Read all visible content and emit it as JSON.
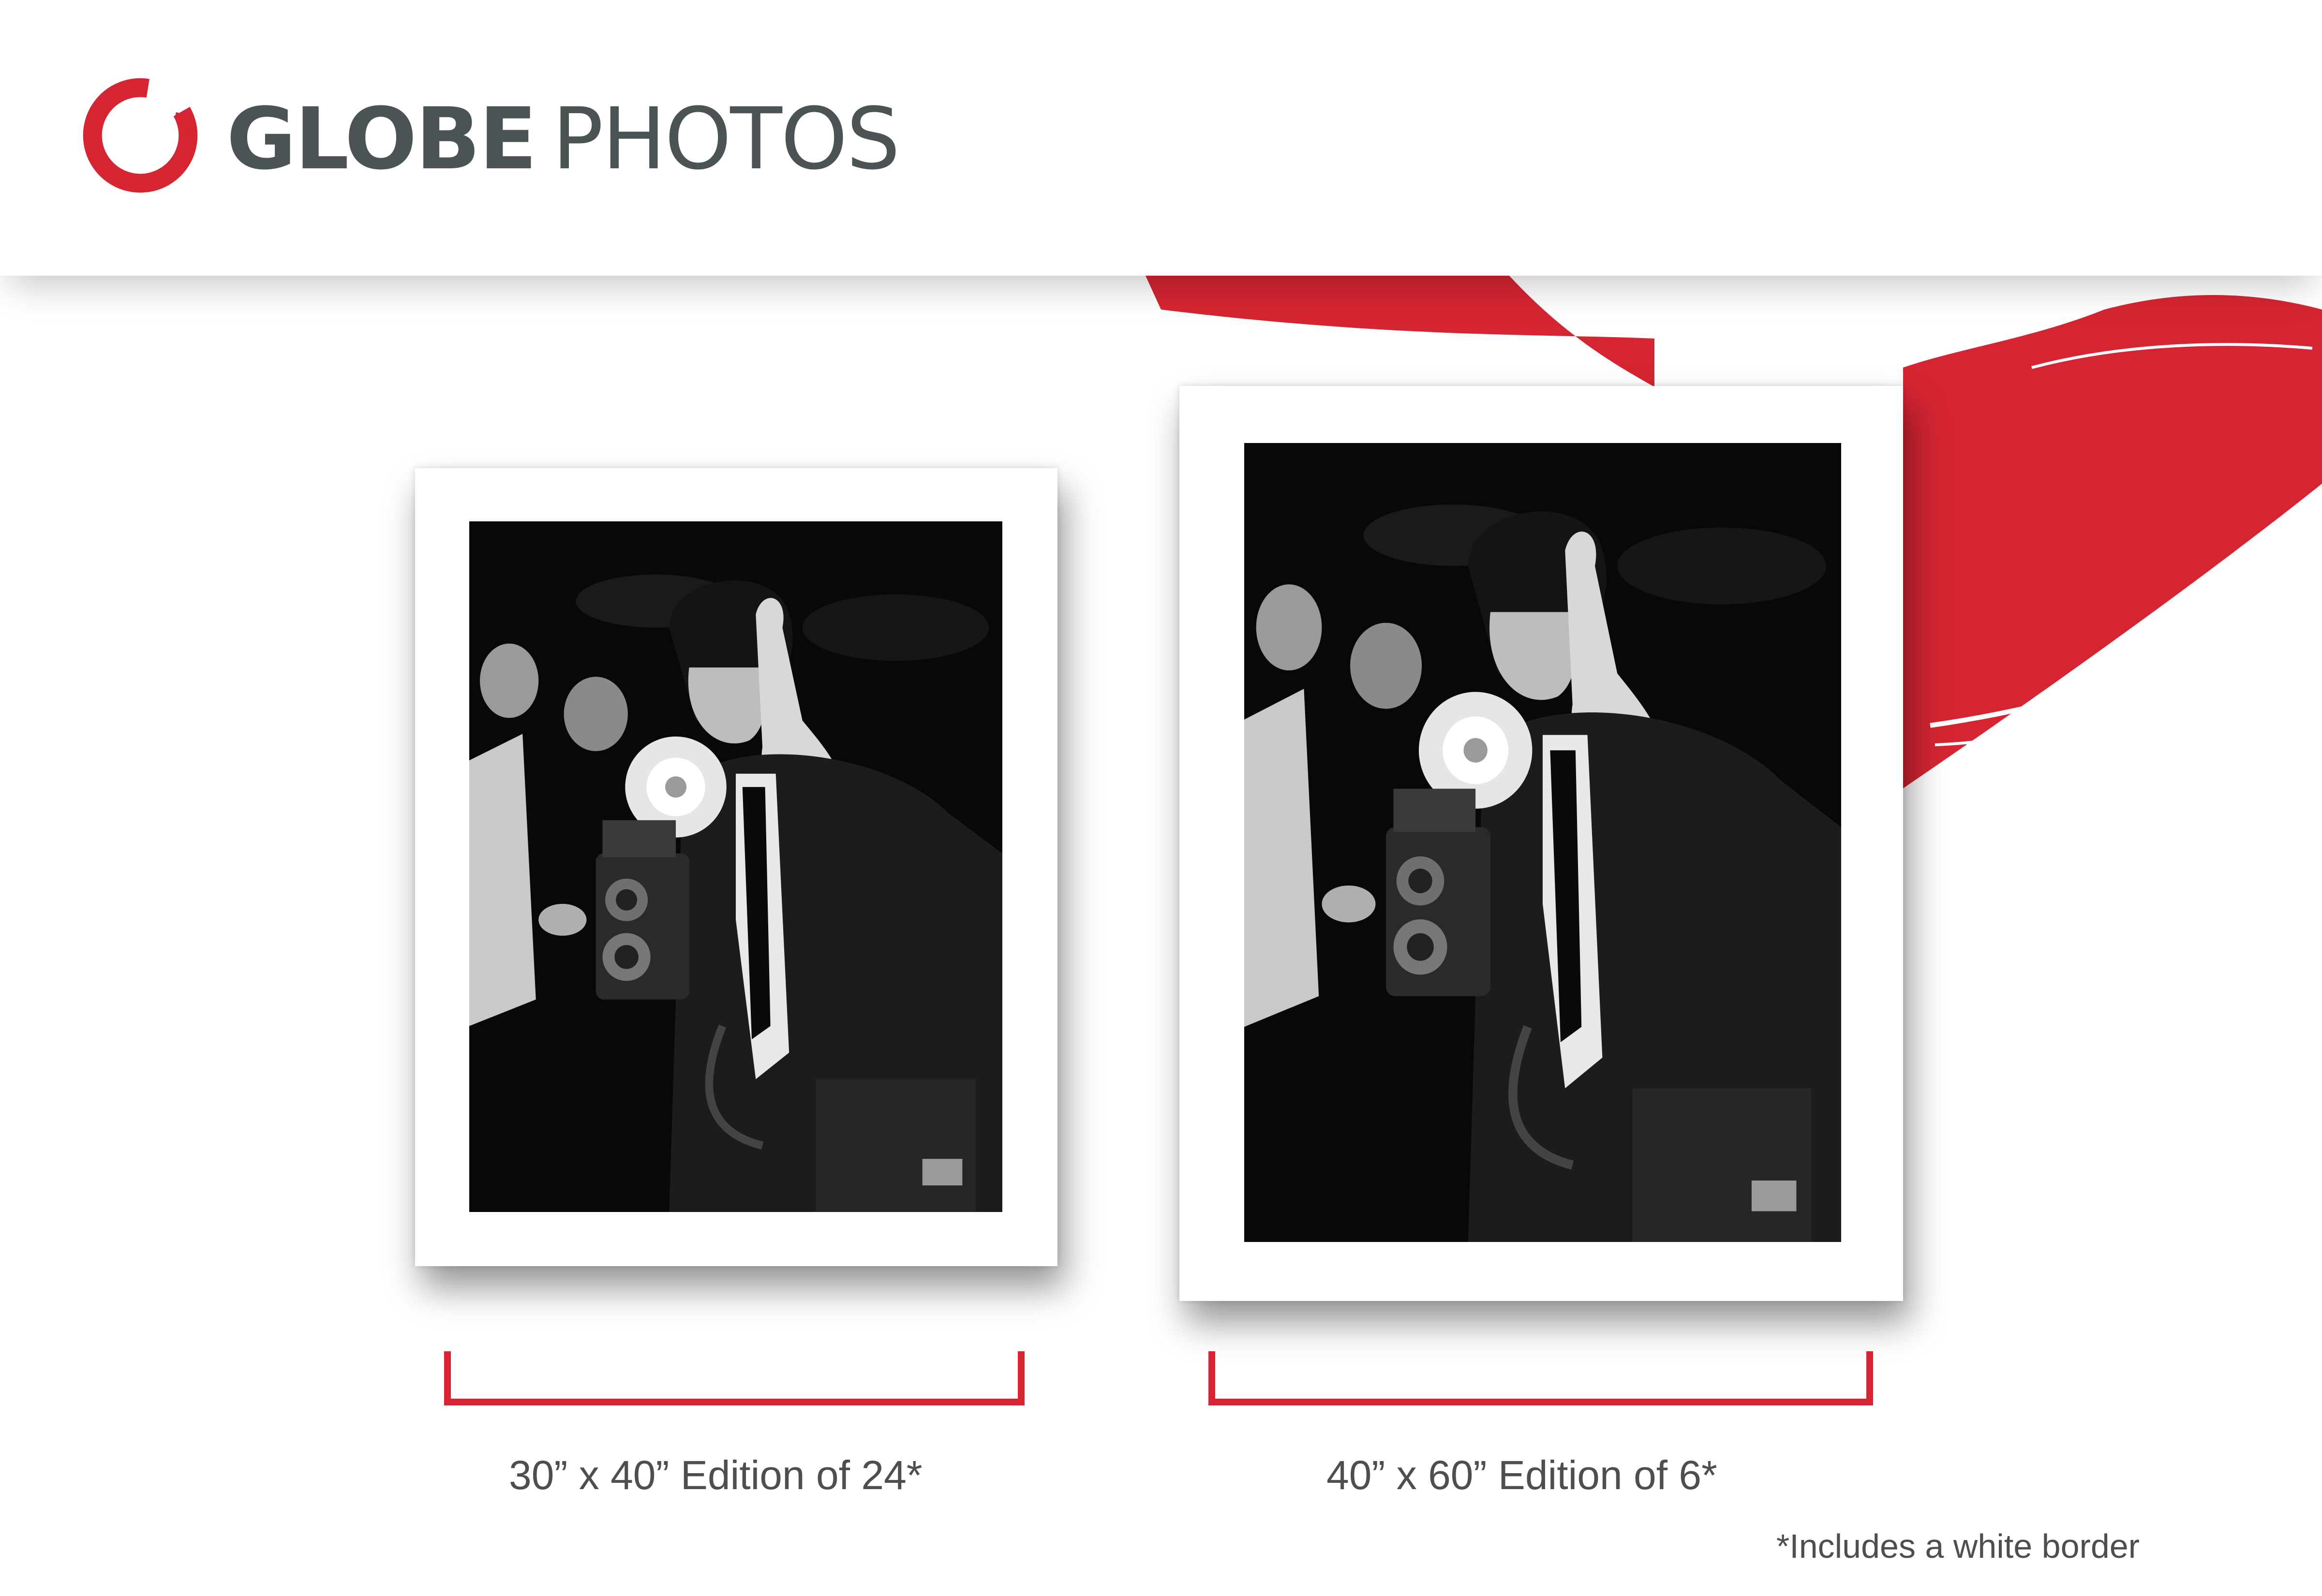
{
  "brand": {
    "name_bold": "GLOBE",
    "name_light": "PHOTOS",
    "logo_icon": "red-brush-circle-logo",
    "accent_color": "#d52532",
    "text_color": "#4b5355"
  },
  "prints": [
    {
      "photo_subject": "black-and-white-photo-of-man-with-vintage-flash-camera"
    },
    {
      "photo_subject": "black-and-white-photo-of-man-with-vintage-flash-camera"
    }
  ],
  "sizes": [
    {
      "label": "30” x 40” Edition of 24*"
    },
    {
      "label": "40” x 60” Edition of 6*"
    }
  ],
  "footnote": "*Includes a white border"
}
